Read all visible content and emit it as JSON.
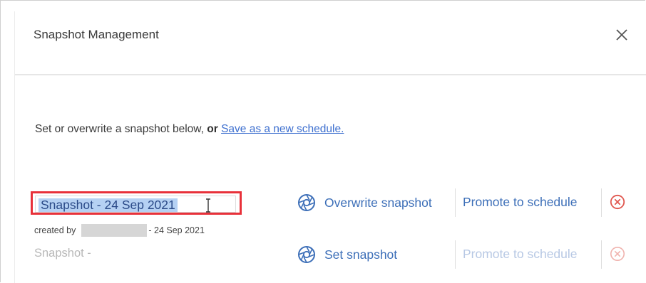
{
  "dialog": {
    "title": "Snapshot Management",
    "close_icon": "close-icon"
  },
  "intro": {
    "text": "Set or overwrite a snapshot below, ",
    "or_text": "or",
    "link_label": "Save as a new schedule."
  },
  "snapshots": [
    {
      "name": "Snapshot - 24 Sep 2021",
      "created_by_label": "created by",
      "created_date": "- 24 Sep 2021",
      "action_label": "Overwrite snapshot",
      "action_icon": "aperture-icon",
      "promote_label": "Promote to schedule",
      "delete_icon": "delete-circle-icon"
    },
    {
      "name": "Snapshot -",
      "action_label": "Set snapshot",
      "action_icon": "aperture-icon",
      "promote_label": "Promote to schedule",
      "delete_icon": "delete-circle-icon"
    }
  ],
  "colors": {
    "accent": "#3d6fb8",
    "danger": "#e0574f",
    "highlight_border": "#e8313a",
    "selection": "#b5d1f3"
  }
}
